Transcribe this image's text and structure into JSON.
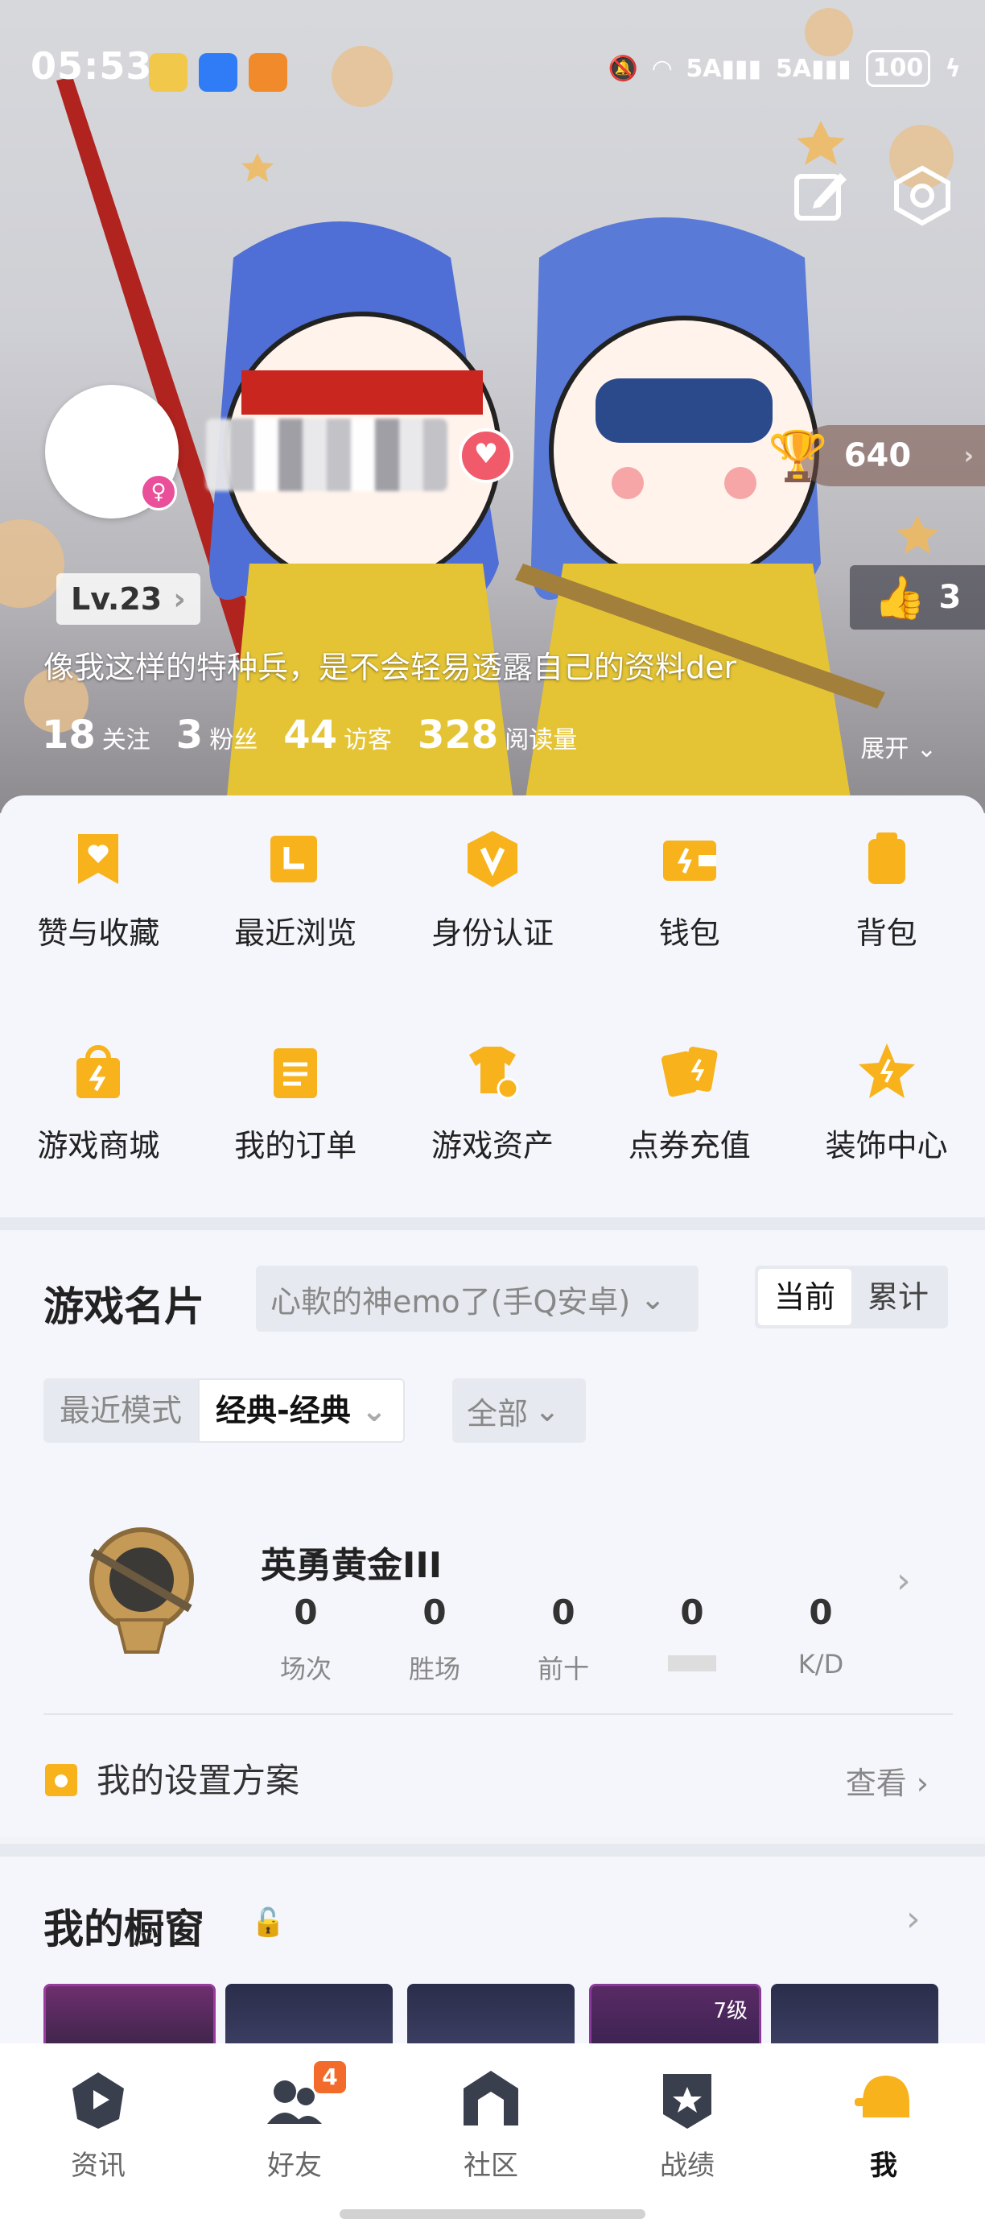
{
  "status_bar": {
    "time": "05:53",
    "network1": "5A",
    "network2": "5A",
    "battery": "100"
  },
  "profile": {
    "trophy_score": "640",
    "level": "Lv.23",
    "likes": "3",
    "bio": "像我这样的特种兵，是不会轻易透露自己的资料der",
    "stats": [
      {
        "num": "18",
        "label": "关注"
      },
      {
        "num": "3",
        "label": "粉丝"
      },
      {
        "num": "44",
        "label": "访客"
      },
      {
        "num": "328",
        "label": "阅读量"
      }
    ],
    "expand_label": "展开"
  },
  "grid": [
    {
      "label": "赞与收藏",
      "icon": "heart-bookmark-icon"
    },
    {
      "label": "最近浏览",
      "icon": "recent-icon"
    },
    {
      "label": "身份认证",
      "icon": "verified-icon"
    },
    {
      "label": "钱包",
      "icon": "wallet-icon"
    },
    {
      "label": "背包",
      "icon": "backpack-icon"
    },
    {
      "label": "游戏商城",
      "icon": "shop-bag-icon"
    },
    {
      "label": "我的订单",
      "icon": "order-clipboard-icon"
    },
    {
      "label": "游戏资产",
      "icon": "shirt-coins-icon"
    },
    {
      "label": "点券充值",
      "icon": "cards-recharge-icon"
    },
    {
      "label": "装饰中心",
      "icon": "star-decor-icon"
    }
  ],
  "game_card": {
    "title": "游戏名片",
    "account": "心軟的神emo了(手Q安卓)",
    "segments": [
      "当前",
      "累计"
    ],
    "mode_key": "最近模式",
    "mode_value": "经典-经典",
    "filter": "全部",
    "rank_name": "英勇黄金III",
    "rank_stats": [
      {
        "value": "0",
        "label": "场次"
      },
      {
        "value": "0",
        "label": "胜场"
      },
      {
        "value": "0",
        "label": "前十"
      },
      {
        "value": "0",
        "label": ""
      },
      {
        "value": "0",
        "label": "K/D"
      }
    ],
    "settings_label": "我的设置方案",
    "view_label": "查看"
  },
  "showcase": {
    "title": "我的橱窗",
    "level_badge": "7级"
  },
  "tabbar": [
    {
      "label": "资讯",
      "icon": "news-play-icon"
    },
    {
      "label": "好友",
      "icon": "friends-icon",
      "badge": "4"
    },
    {
      "label": "社区",
      "icon": "community-house-icon"
    },
    {
      "label": "战绩",
      "icon": "record-shield-icon"
    },
    {
      "label": "我",
      "icon": "me-helmet-icon"
    }
  ],
  "colors": {
    "accent": "#f7b21c",
    "badge": "#f26b2a"
  }
}
